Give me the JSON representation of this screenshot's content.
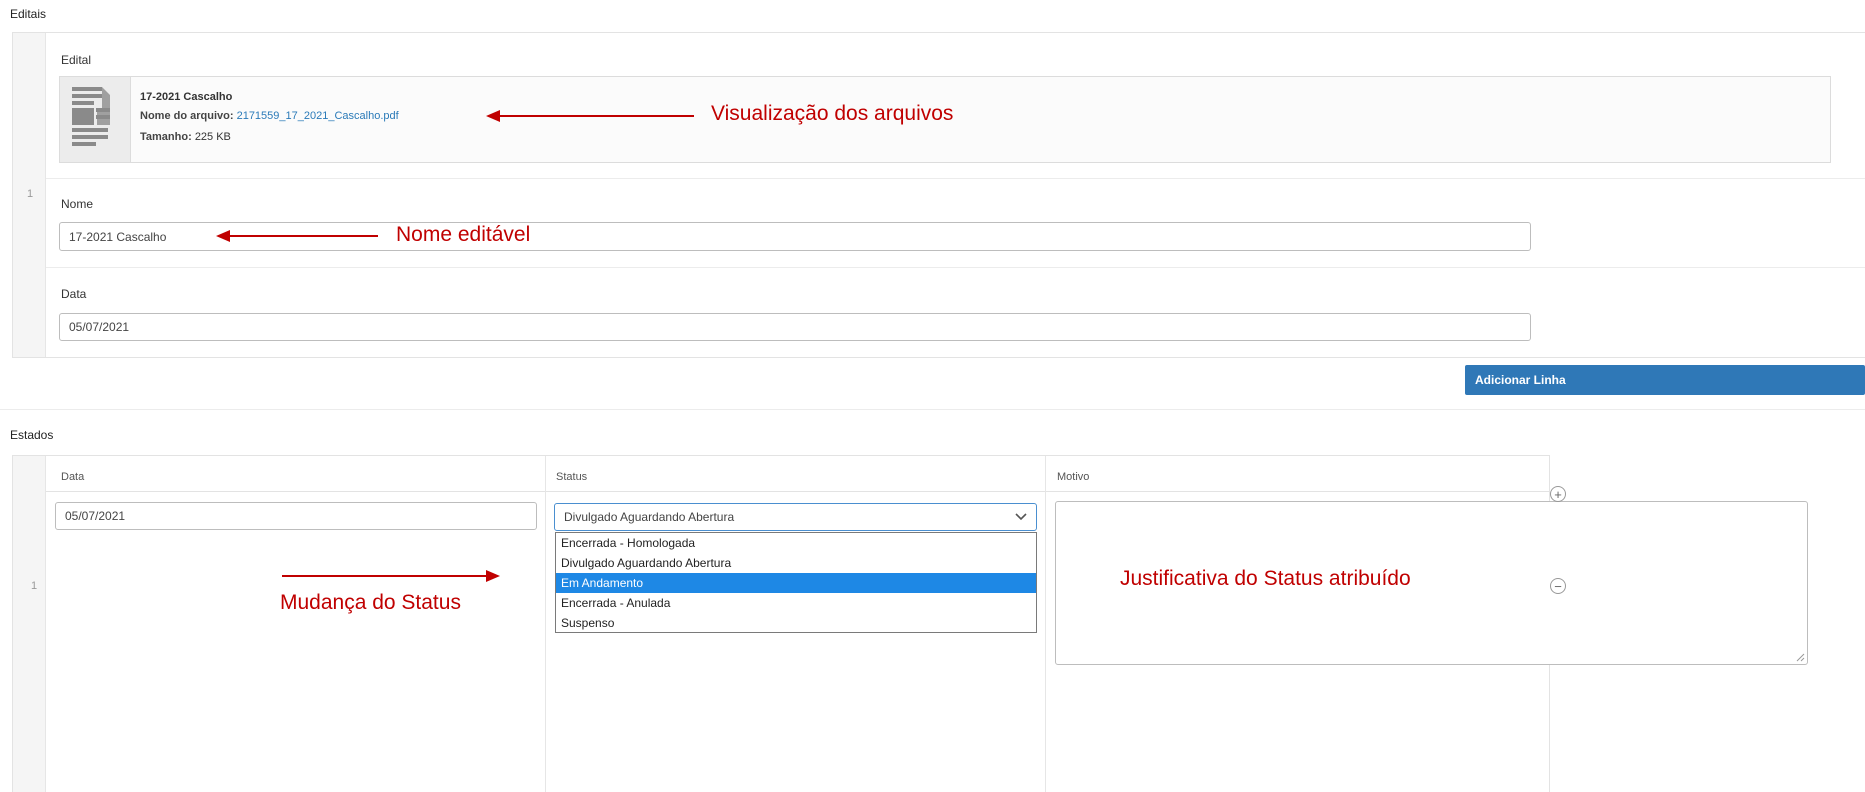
{
  "editais": {
    "section_title": "Editais",
    "row_number": "1",
    "edital_label": "Edital",
    "file": {
      "title": "17-2021 Cascalho",
      "filename_label": "Nome do arquivo:",
      "filename": "2171559_17_2021_Cascalho.pdf",
      "size_label": "Tamanho:",
      "size": "225 KB",
      "icon": "document-icon"
    },
    "nome_label": "Nome",
    "nome_value": "17-2021 Cascalho",
    "data_label": "Data",
    "data_value": "05/07/2021"
  },
  "add_row_button": "Adicionar Linha",
  "estados": {
    "section_title": "Estados",
    "columns": {
      "data": "Data",
      "status": "Status",
      "motivo": "Motivo"
    },
    "row_number": "1",
    "row": {
      "data": "05/07/2021",
      "status": "Divulgado Aguardando Abertura"
    },
    "status_options": [
      "Encerrada - Homologada",
      "Divulgado Aguardando Abertura",
      "Em Andamento",
      "Encerrada - Anulada",
      "Suspenso"
    ],
    "highlighted_option": "Em Andamento"
  },
  "annotations": {
    "files": "Visualização dos arquivos",
    "name": "Nome editável",
    "status": "Mudança do Status",
    "justification": "Justificativa do Status atribuído"
  },
  "colors": {
    "accent": "#2f78b7",
    "annotation": "#c00000",
    "selected_option": "#1e88e5"
  }
}
